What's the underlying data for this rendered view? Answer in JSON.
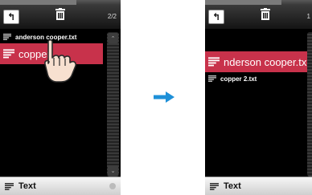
{
  "left_screen": {
    "back_label": "↰",
    "page_indicator": "2/2",
    "files": [
      {
        "name": "anderson cooper.txt"
      },
      {
        "name": "copper"
      }
    ],
    "bottom_label": "Text"
  },
  "right_screen": {
    "back_label": "↰",
    "page_indicator": "1",
    "files": [
      {
        "name": "nderson cooper.tx"
      },
      {
        "name": "copper 2.txt"
      }
    ],
    "bottom_label": "Text"
  },
  "scroll_up": "⌃",
  "scroll_down": "⌄",
  "colors": {
    "accent": "#c8324b",
    "arrow": "#1e90d8"
  },
  "icons": [
    "back-icon",
    "trash-icon",
    "text-file-icon",
    "hand-cursor-icon",
    "arrow-right-icon"
  ]
}
